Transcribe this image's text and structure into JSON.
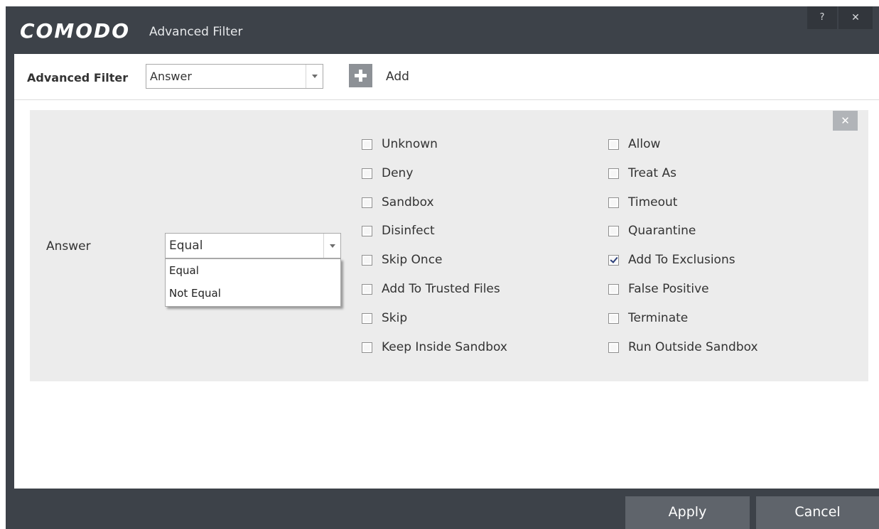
{
  "window": {
    "brand": "COMODO",
    "title": "Advanced Filter",
    "help_glyph": "?",
    "close_glyph": "✕"
  },
  "toolbar": {
    "label": "Advanced Filter",
    "filter_select": {
      "value": "Answer"
    },
    "add_label": "Add"
  },
  "panel": {
    "close_glyph": "✕",
    "field_label": "Answer",
    "condition_select": {
      "value": "Equal",
      "options": [
        "Equal",
        "Not Equal"
      ]
    },
    "options_left": [
      {
        "label": "Unknown",
        "checked": false
      },
      {
        "label": "Deny",
        "checked": false
      },
      {
        "label": "Sandbox",
        "checked": false
      },
      {
        "label": "Disinfect",
        "checked": false
      },
      {
        "label": "Skip Once",
        "checked": false
      },
      {
        "label": "Add To Trusted Files",
        "checked": false
      },
      {
        "label": "Skip",
        "checked": false
      },
      {
        "label": "Keep Inside Sandbox",
        "checked": false
      }
    ],
    "options_right": [
      {
        "label": "Allow",
        "checked": false
      },
      {
        "label": "Treat As",
        "checked": false
      },
      {
        "label": "Timeout",
        "checked": false
      },
      {
        "label": "Quarantine",
        "checked": false
      },
      {
        "label": "Add To Exclusions",
        "checked": true
      },
      {
        "label": "False Positive",
        "checked": false
      },
      {
        "label": "Terminate",
        "checked": false
      },
      {
        "label": "Run Outside Sandbox",
        "checked": false
      }
    ]
  },
  "footer": {
    "apply_label": "Apply",
    "cancel_label": "Cancel"
  }
}
